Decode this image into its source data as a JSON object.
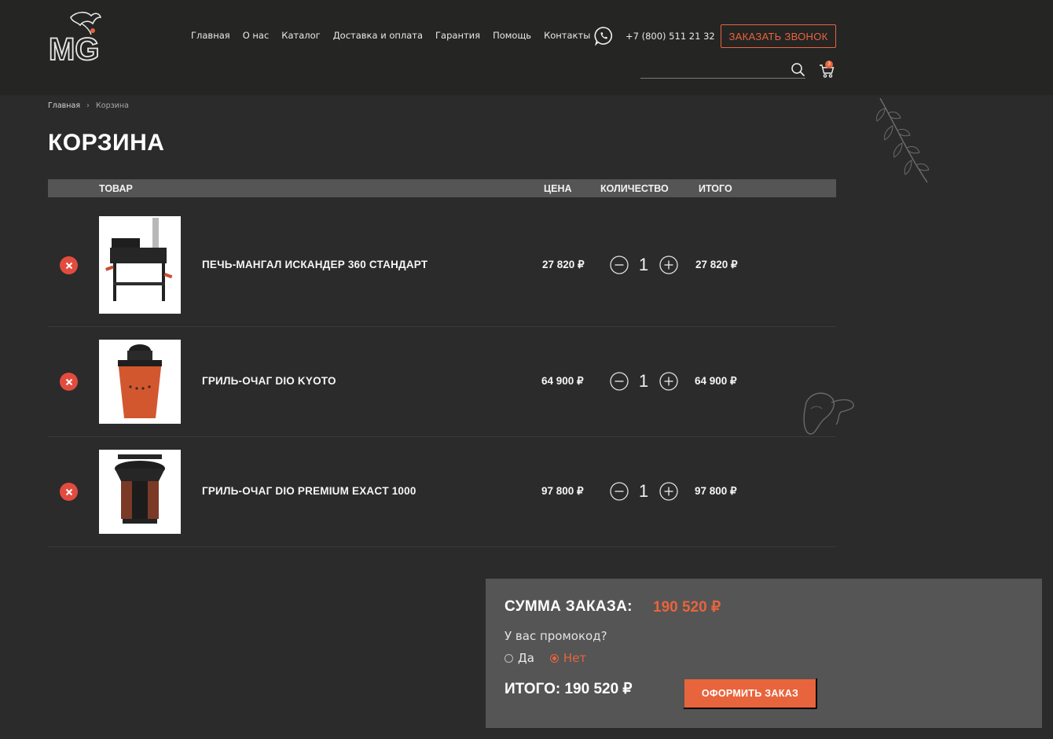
{
  "header": {
    "nav": [
      "Главная",
      "О нас",
      "Каталог",
      "Доставка и оплата",
      "Гарантия",
      "Помощь",
      "Контакты"
    ],
    "phone": "+7 (800) 511 21 32",
    "callback_label": "ЗАКАЗАТЬ ЗВОНОК",
    "cart_count": "3",
    "logo_text": "MG"
  },
  "breadcrumb": {
    "home": "Главная",
    "current": "Корзина"
  },
  "page_title": "КОРЗИНА",
  "table": {
    "headers": {
      "product": "ТОВАР",
      "price": "ЦЕНА",
      "quantity": "КОЛИЧЕСТВО",
      "total": "ИТОГО"
    },
    "rows": [
      {
        "name": "ПЕЧЬ-МАНГАЛ ИСКАНДЕР 360 СТАНДАРТ",
        "price": "27 820 ₽",
        "qty": "1",
        "total": "27 820 ₽"
      },
      {
        "name": "ГРИЛЬ-ОЧАГ DIO KYOTO",
        "price": "64 900 ₽",
        "qty": "1",
        "total": "64 900 ₽"
      },
      {
        "name": "ГРИЛЬ-ОЧАГ DIO PREMIUM EXACT 1000",
        "price": "97 800 ₽",
        "qty": "1",
        "total": "97 800 ₽"
      }
    ]
  },
  "summary": {
    "label": "СУММА ЗАКАЗА:",
    "value": "190 520 ₽",
    "promo_question": "У вас промокод?",
    "promo_yes": "Да",
    "promo_no": "Нет",
    "promo_selected": "Нет",
    "grand_total": "ИТОГО: 190 520 ₽",
    "checkout_label": "ОФОРМИТЬ ЗАКАЗ"
  },
  "colors": {
    "accent": "#e8643c",
    "remove": "#e24c3f",
    "header_bg": "#252524",
    "page_bg": "#2b2b2b",
    "panel_bg": "#555555"
  },
  "icons": [
    "logo-dragon-icon",
    "whatsapp-icon",
    "search-icon",
    "cart-icon",
    "remove-icon",
    "minus-icon",
    "plus-icon",
    "leaf-decoration-icon",
    "mushroom-decoration-icon"
  ]
}
